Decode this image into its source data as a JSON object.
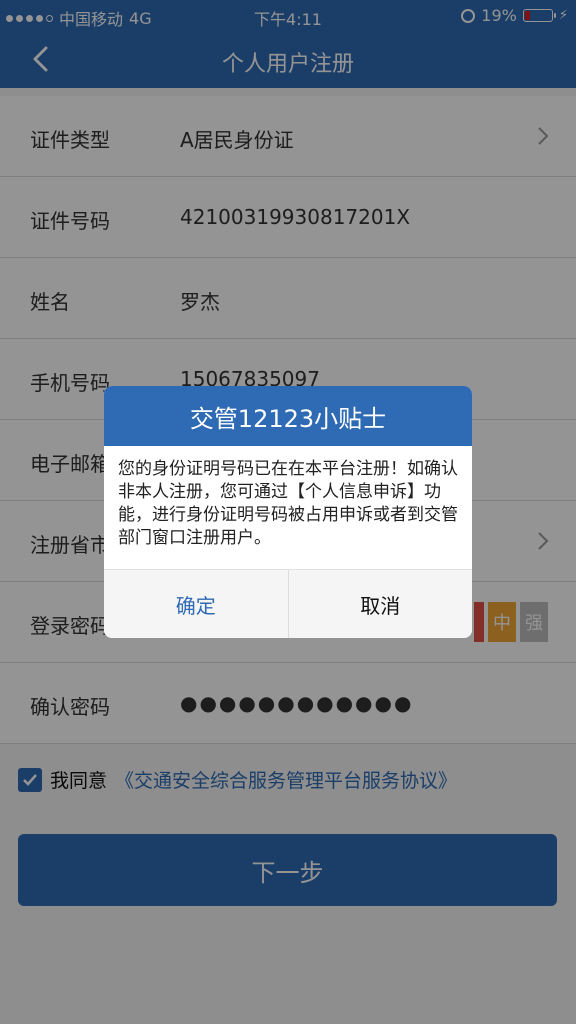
{
  "status_bar": {
    "carrier": "中国移动",
    "network": "4G",
    "time": "下午4:11",
    "battery": "19%"
  },
  "nav": {
    "title": "个人用户注册"
  },
  "form": {
    "rows": [
      {
        "label": "证件类型",
        "value": "A居民身份证"
      },
      {
        "label": "证件号码",
        "value": "42100319930817201X"
      },
      {
        "label": "姓名",
        "value": "罗杰"
      },
      {
        "label": "手机号码",
        "value": "15067835097"
      },
      {
        "label": "电子邮箱",
        "value": ""
      },
      {
        "label": "注册省市",
        "value": ""
      },
      {
        "label": "登录密码",
        "value": ""
      },
      {
        "label": "确认密码",
        "value": "●●●●●●●●●●●●"
      }
    ],
    "strength": {
      "mid": "中",
      "strong": "强"
    }
  },
  "agreement": {
    "checked": true,
    "prefix": "我同意",
    "link": "《交通安全综合服务管理平台服务协议》"
  },
  "next_button": "下一步",
  "dialog": {
    "title": "交管12123小贴士",
    "message": "您的身份证明号码已在在本平台注册！如确认非本人注册，您可通过【个人信息申诉】功能，进行身份证明号码被占用申诉或者到交管部门窗口注册用户。",
    "confirm": "确定",
    "cancel": "取消"
  },
  "colors": {
    "primary": "#2f6bb5",
    "weak": "#e35045",
    "mid": "#f2a535",
    "strong": "#bdbdbd"
  }
}
